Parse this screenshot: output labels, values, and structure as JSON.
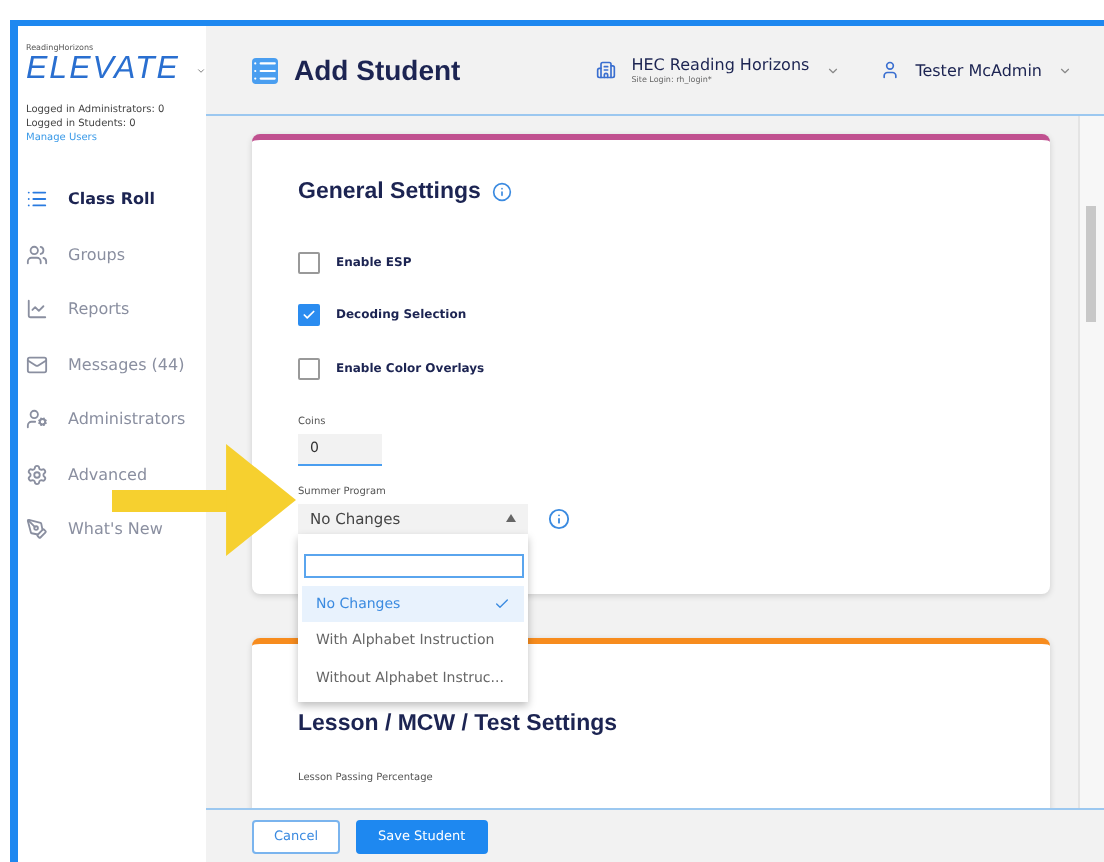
{
  "sidebar": {
    "brand": "ReadingHorizons",
    "logo": "ELEVATE",
    "stats": [
      "Logged in Administrators: 0",
      "Logged in Students: 0"
    ],
    "manage_link": "Manage Users",
    "items": [
      {
        "label": "Class Roll",
        "selected": true
      },
      {
        "label": "Groups",
        "selected": false
      },
      {
        "label": "Reports",
        "selected": false
      },
      {
        "label": "Messages  (44)",
        "selected": false
      },
      {
        "label": "Administrators",
        "selected": false
      },
      {
        "label": "Advanced",
        "selected": false
      },
      {
        "label": "What's New",
        "selected": false
      }
    ]
  },
  "header": {
    "title": "Add Student",
    "organization": "HEC Reading Horizons",
    "site_login": "Site Login: rh_login*",
    "user": "Tester McAdmin"
  },
  "general_settings": {
    "title": "General Settings",
    "checkboxes": [
      {
        "label": "Enable ESP",
        "checked": false
      },
      {
        "label": "Decoding Selection",
        "checked": true
      },
      {
        "label": "Enable Color Overlays",
        "checked": false
      }
    ],
    "coins": {
      "label": "Coins",
      "value": "0"
    },
    "summer_program": {
      "label": "Summer Program",
      "value": "No Changes",
      "expanded": true,
      "options": [
        {
          "label": "No Changes",
          "selected": true
        },
        {
          "label": "With Alphabet Instruction",
          "selected": false
        },
        {
          "label": "Without Alphabet Instruc...",
          "selected": false
        }
      ]
    }
  },
  "lesson_settings": {
    "title": "Lesson / MCW / Test Settings",
    "field_label": "Lesson Passing Percentage"
  },
  "buttons": [
    {
      "label": "Cancel",
      "kind": "secondary"
    },
    {
      "label": "Save Student",
      "kind": "primary"
    }
  ]
}
